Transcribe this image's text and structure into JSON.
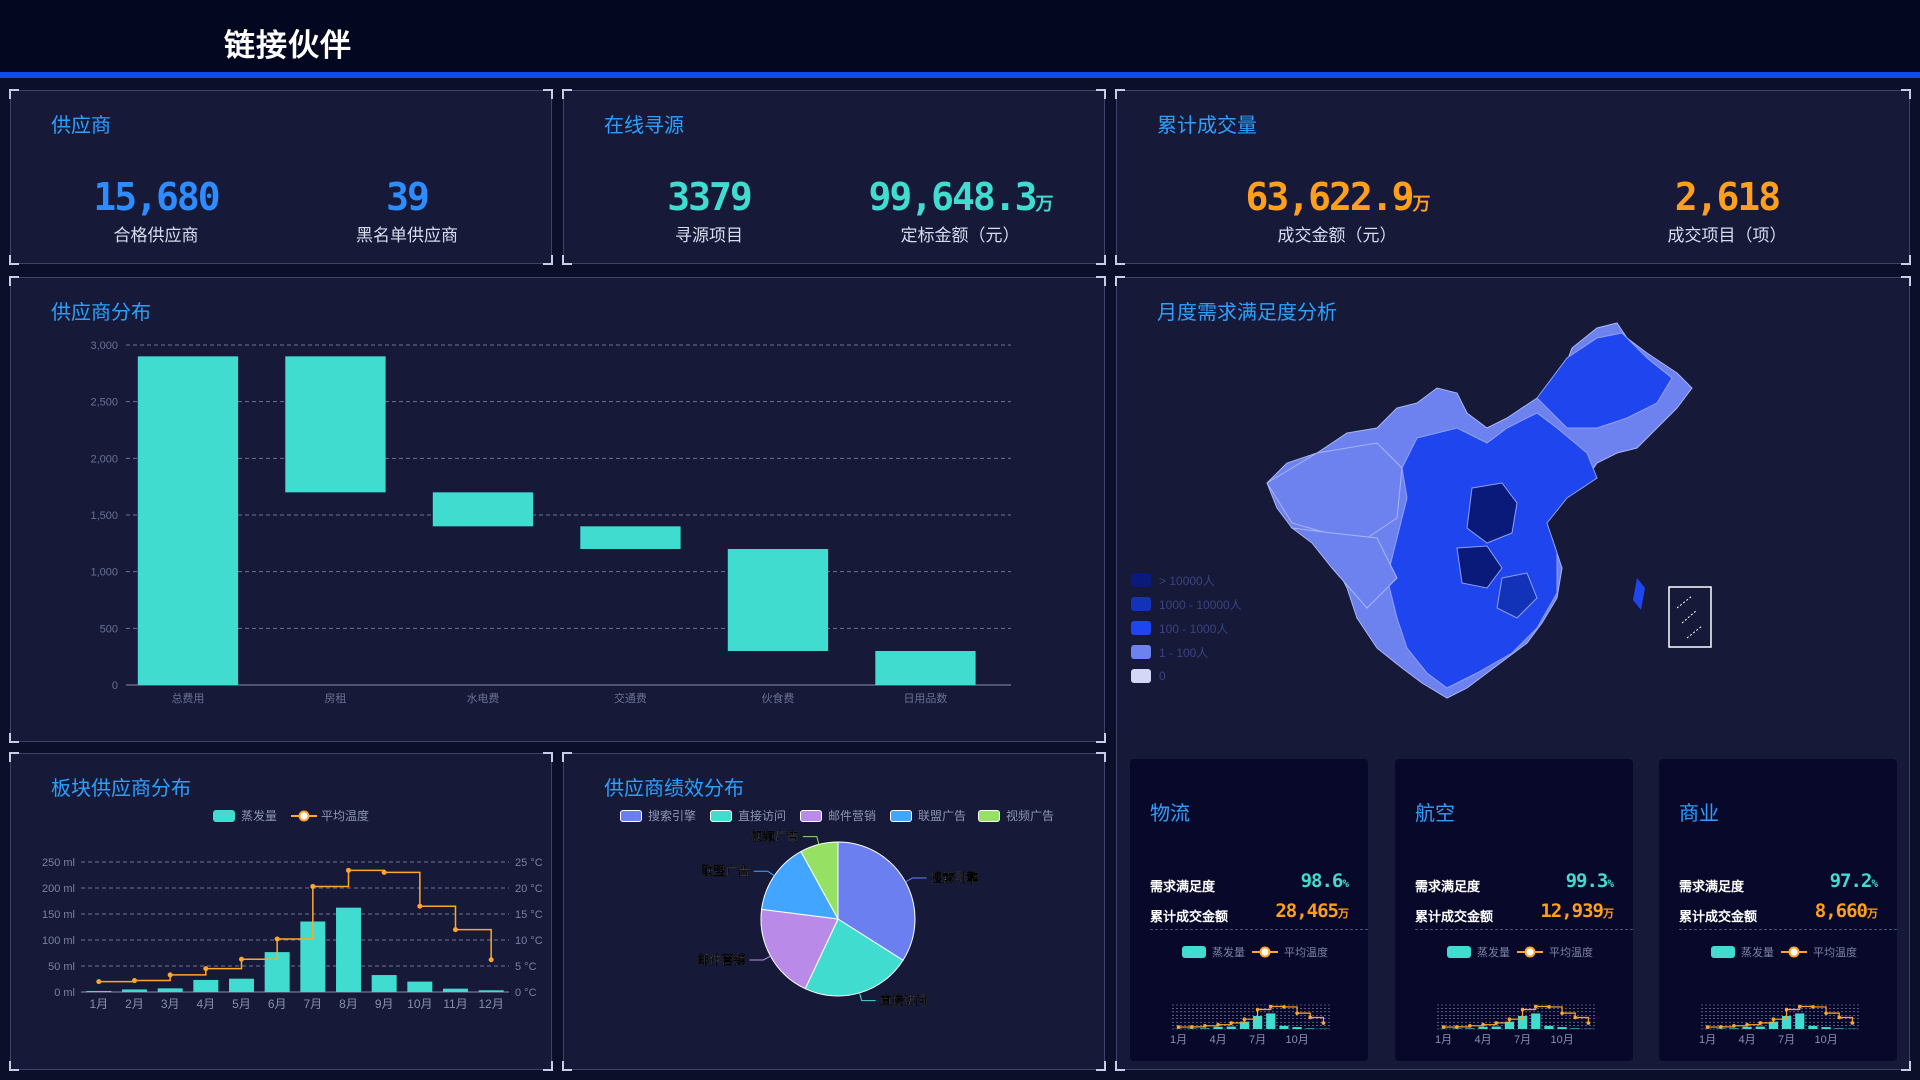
{
  "app": {
    "title": "链接伙伴"
  },
  "kpi_panels": [
    {
      "title": "供应商",
      "items": [
        {
          "value": "15,680",
          "unit": "",
          "label": "合格供应商"
        },
        {
          "value": "39",
          "unit": "",
          "label": "黑名单供应商"
        }
      ]
    },
    {
      "title": "在线寻源",
      "items": [
        {
          "value": "3379",
          "unit": "",
          "label": "寻源项目"
        },
        {
          "value": "99,648.3",
          "unit": "万",
          "label": "定标金额（元）"
        }
      ]
    },
    {
      "title": "累计成交量",
      "items": [
        {
          "value": "63,622.9",
          "unit": "万",
          "label": "成交金额（元）"
        },
        {
          "value": "2,618",
          "unit": "",
          "label": "成交项目（项）"
        }
      ]
    }
  ],
  "distribution": {
    "title": "供应商分布",
    "chart_data": {
      "type": "bar",
      "subtype": "waterfall",
      "categories": [
        "总费用",
        "房租",
        "水电费",
        "交通费",
        "伙食费",
        "日用品数"
      ],
      "base": [
        0,
        1700,
        1400,
        1200,
        300,
        0
      ],
      "values": [
        2900,
        1200,
        300,
        200,
        900,
        300
      ],
      "yticks": [
        "0",
        "500",
        "1,000",
        "1,500",
        "2,000",
        "2,500",
        "3,000"
      ],
      "ylim": [
        0,
        3000
      ],
      "color": "#40dcd0"
    }
  },
  "map": {
    "title": "月度需求满足度分析",
    "legend": [
      {
        "label": "> 10000人",
        "color": "#0a1a7a"
      },
      {
        "label": "1000 - 10000人",
        "color": "#1232b8"
      },
      {
        "label": "100 - 1000人",
        "color": "#1f45ee"
      },
      {
        "label": "1 - 100人",
        "color": "#6d82ef"
      },
      {
        "label": "0",
        "color": "#d4d8f6"
      }
    ]
  },
  "sector_chart": {
    "title": "板块供应商分布",
    "legend_bar": "蒸发量",
    "legend_line": "平均温度",
    "chart_data": {
      "type": "bar",
      "categories": [
        "1月",
        "2月",
        "3月",
        "4月",
        "5月",
        "6月",
        "7月",
        "8月",
        "9月",
        "10月",
        "11月",
        "12月"
      ],
      "series": [
        {
          "name": "蒸发量",
          "values": [
            2.0,
            4.9,
            7.0,
            23.2,
            25.6,
            76.7,
            135.6,
            162.2,
            32.6,
            20.0,
            6.4,
            3.3
          ]
        },
        {
          "name": "平均温度",
          "values": [
            2.0,
            2.2,
            3.3,
            4.5,
            6.3,
            10.2,
            20.3,
            23.4,
            23.0,
            16.5,
            12.0,
            6.2
          ]
        }
      ],
      "y_left_ticks": [
        "0 ml",
        "50 ml",
        "100 ml",
        "150 ml",
        "200 ml",
        "250 ml"
      ],
      "y_right_ticks": [
        "0 °C",
        "5 °C",
        "10 °C",
        "15 °C",
        "20 °C",
        "25 °C"
      ],
      "ylim": [
        0,
        250
      ],
      "y2lim": [
        0,
        25
      ]
    }
  },
  "performance": {
    "title": "供应商绩效分布",
    "chart_data": {
      "type": "pie",
      "labels": [
        "搜索引擎",
        "直接访问",
        "邮件营销",
        "联盟广告",
        "视频广告"
      ],
      "values": [
        34,
        23,
        20,
        15,
        8
      ],
      "colors": [
        "#6b7ff0",
        "#40dcd0",
        "#b98ae8",
        "#42a5ff",
        "#96e063"
      ]
    }
  },
  "sectors": [
    {
      "name": "物流",
      "satisfaction_label": "需求满足度",
      "satisfaction": "98.6",
      "satisfaction_unit": "%",
      "amount_label": "累计成交金额",
      "amount": "28,465",
      "amount_unit": "万"
    },
    {
      "name": "航空",
      "satisfaction_label": "需求满足度",
      "satisfaction": "99.3",
      "satisfaction_unit": "%",
      "amount_label": "累计成交金额",
      "amount": "12,939",
      "amount_unit": "万"
    },
    {
      "name": "商业",
      "satisfaction_label": "需求满足度",
      "satisfaction": "97.2",
      "satisfaction_unit": "%",
      "amount_label": "累计成交金额",
      "amount": "8,660",
      "amount_unit": "万"
    }
  ],
  "mini_chart": {
    "legend_bar": "蒸发量",
    "legend_line": "平均温度",
    "x_labels": [
      "1月",
      "4月",
      "7月",
      "10月"
    ],
    "chart_data": {
      "type": "bar",
      "categories": [
        "1月",
        "2月",
        "3月",
        "4月",
        "5月",
        "6月",
        "7月",
        "8月",
        "9月",
        "10月",
        "11月",
        "12月"
      ],
      "series": [
        {
          "name": "蒸发量",
          "values": [
            2.0,
            4.9,
            7.0,
            23.2,
            25.6,
            76.7,
            135.6,
            162.2,
            32.6,
            20.0,
            6.4,
            3.3
          ]
        },
        {
          "name": "平均温度",
          "values": [
            2.0,
            2.2,
            3.3,
            4.5,
            6.3,
            10.2,
            20.3,
            23.4,
            23.0,
            16.5,
            12.0,
            6.2
          ]
        }
      ]
    }
  }
}
